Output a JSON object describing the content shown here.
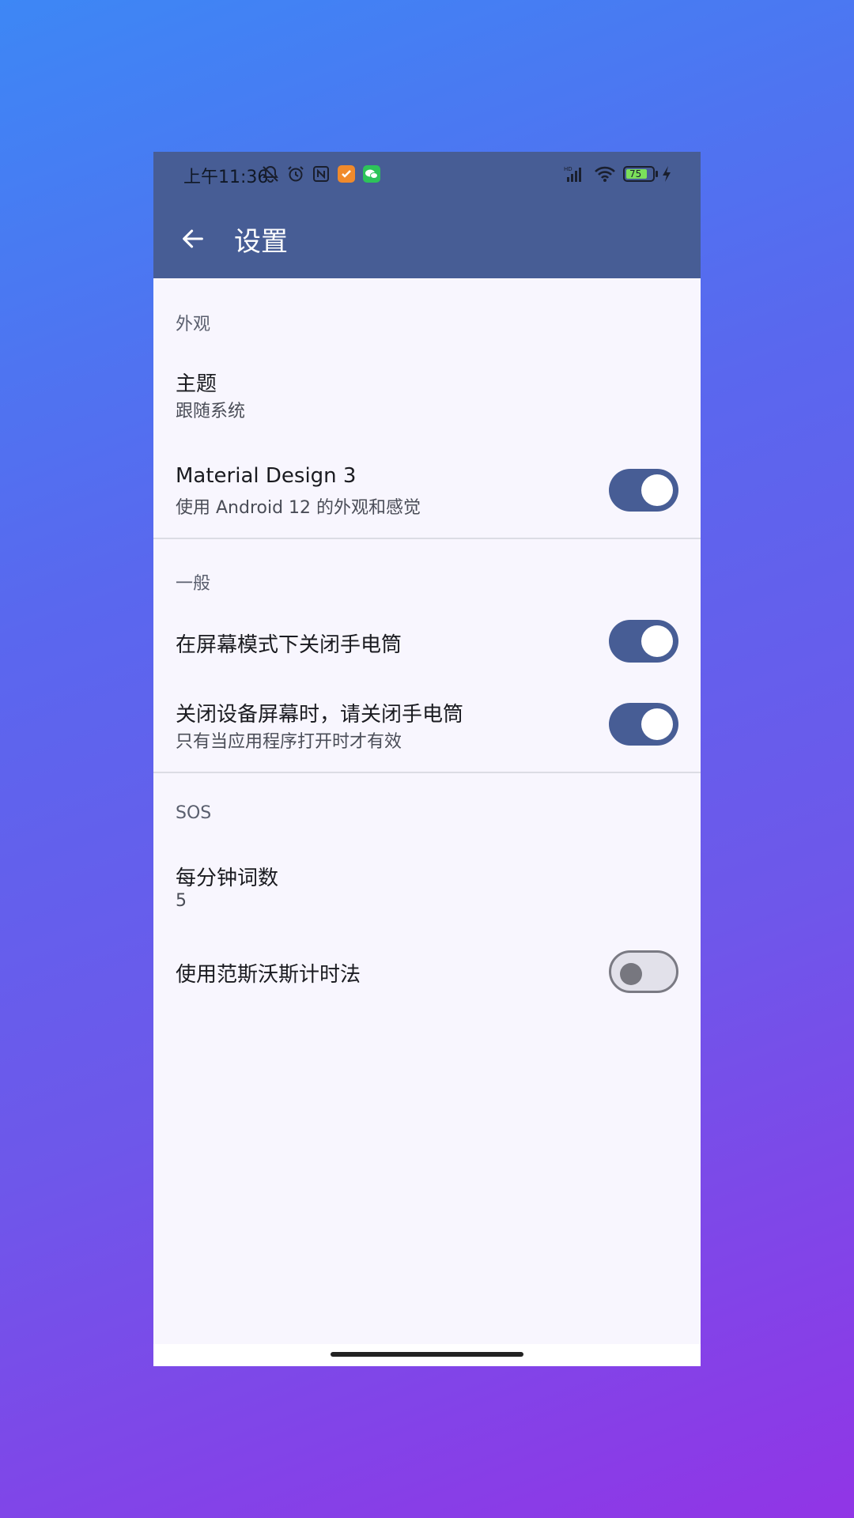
{
  "status_bar": {
    "time": "上午11:36",
    "battery": "75",
    "left_icons": [
      "mute-bell-icon",
      "alarm-icon",
      "nfc-icon",
      "orange-app-icon",
      "wechat-icon"
    ],
    "right_icons": [
      "hd-signal-icon",
      "wifi-icon",
      "battery-icon",
      "charging-icon"
    ]
  },
  "appbar": {
    "title": "设置",
    "back_icon": "arrow-left-icon"
  },
  "sections": {
    "appearance": {
      "header": "外观",
      "theme": {
        "title": "主题",
        "summary": "跟随系统"
      },
      "material": {
        "title": "Material Design 3",
        "summary": "使用 Android 12 的外观和感觉",
        "enabled": true
      }
    },
    "general": {
      "header": "一般",
      "screen_mode": {
        "title": "在屏幕模式下关闭手电筒",
        "enabled": true
      },
      "screen_off": {
        "title": "关闭设备屏幕时，请关闭手电筒",
        "summary": "只有当应用程序打开时才有效",
        "enabled": true
      }
    },
    "sos": {
      "header": "SOS",
      "wpm": {
        "title": "每分钟词数",
        "summary": "5"
      },
      "farnsworth": {
        "title": "使用范斯沃斯计时法",
        "enabled": false
      }
    }
  },
  "colors": {
    "primary": "#475d95",
    "background": "#f8f6fe",
    "switch_off_track": "#e2e1ea",
    "switch_off_thumb": "#77777f"
  }
}
